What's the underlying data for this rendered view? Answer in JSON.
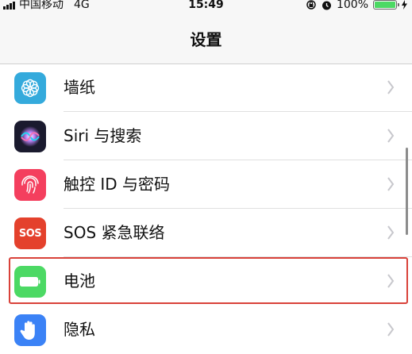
{
  "status_bar": {
    "carrier": "中国移动",
    "network": "4G",
    "time": "15:49",
    "battery_text": "100%",
    "battery_level": 1.0
  },
  "nav": {
    "title": "设置"
  },
  "settings": [
    {
      "label": "墙纸",
      "icon": "wallpaper-icon",
      "color": "#34aadc"
    },
    {
      "label": "Siri 与搜索",
      "icon": "siri-icon",
      "color": "#1a1a2e"
    },
    {
      "label": "触控 ID 与密码",
      "icon": "fingerprint-icon",
      "color": "#f43f5e"
    },
    {
      "label": "SOS 紧急联络",
      "icon": "sos-icon",
      "color": "#e4412c",
      "icon_text": "SOS"
    },
    {
      "label": "电池",
      "icon": "battery-icon",
      "color": "#4cd964",
      "highlighted": true
    },
    {
      "label": "隐私",
      "icon": "hand-icon",
      "color": "#3b82f6"
    }
  ],
  "colors": {
    "highlight_border": "#d9423a",
    "chevron": "#c7c7cc"
  }
}
